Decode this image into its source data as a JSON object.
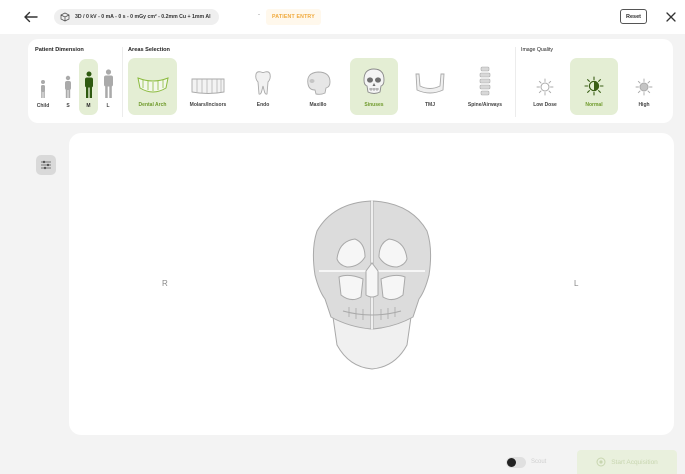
{
  "header": {
    "summary": "3D / 0 kV - 0 mA - 0 s - 0 mGy  cm² - 0.2mm Cu + 1mm Al",
    "separator": "-",
    "patient_entry": "PATIENT ENTRY",
    "reset_label": "Reset"
  },
  "patient_dimension": {
    "title": "Patient Dimension",
    "options": [
      {
        "label": "Child",
        "selected": false
      },
      {
        "label": "S",
        "selected": false
      },
      {
        "label": "M",
        "selected": true
      },
      {
        "label": "L",
        "selected": false
      }
    ]
  },
  "areas_selection": {
    "title": "Areas Selection",
    "options": [
      {
        "label": "Dental Arch",
        "icon": "dental-arch-icon",
        "selected": true
      },
      {
        "label": "Molars/Incisors",
        "icon": "molars-incisors-icon",
        "selected": false
      },
      {
        "label": "Endo",
        "icon": "tooth-icon",
        "selected": false
      },
      {
        "label": "Maxillo",
        "icon": "skull-side-icon",
        "selected": false
      },
      {
        "label": "Sinuses",
        "icon": "skull-front-icon",
        "selected": true
      },
      {
        "label": "TMJ",
        "icon": "jaw-icon",
        "selected": false
      },
      {
        "label": "Spine/Airways",
        "icon": "spine-icon",
        "selected": false
      }
    ]
  },
  "image_quality": {
    "title": "Image Quality",
    "options": [
      {
        "label": "Low Dose",
        "selected": false
      },
      {
        "label": "Normal",
        "selected": true
      },
      {
        "label": "High",
        "selected": false
      }
    ]
  },
  "viewer": {
    "right_side": "R",
    "left_side": "L"
  },
  "footer": {
    "scout_label": "Scout",
    "scout_on": false,
    "start_label": "Start Acquisition"
  },
  "colors": {
    "accent_green": "#6f9a2b",
    "selected_bg": "#e4eed4",
    "patient_entry_orange": "#f0a93b"
  }
}
